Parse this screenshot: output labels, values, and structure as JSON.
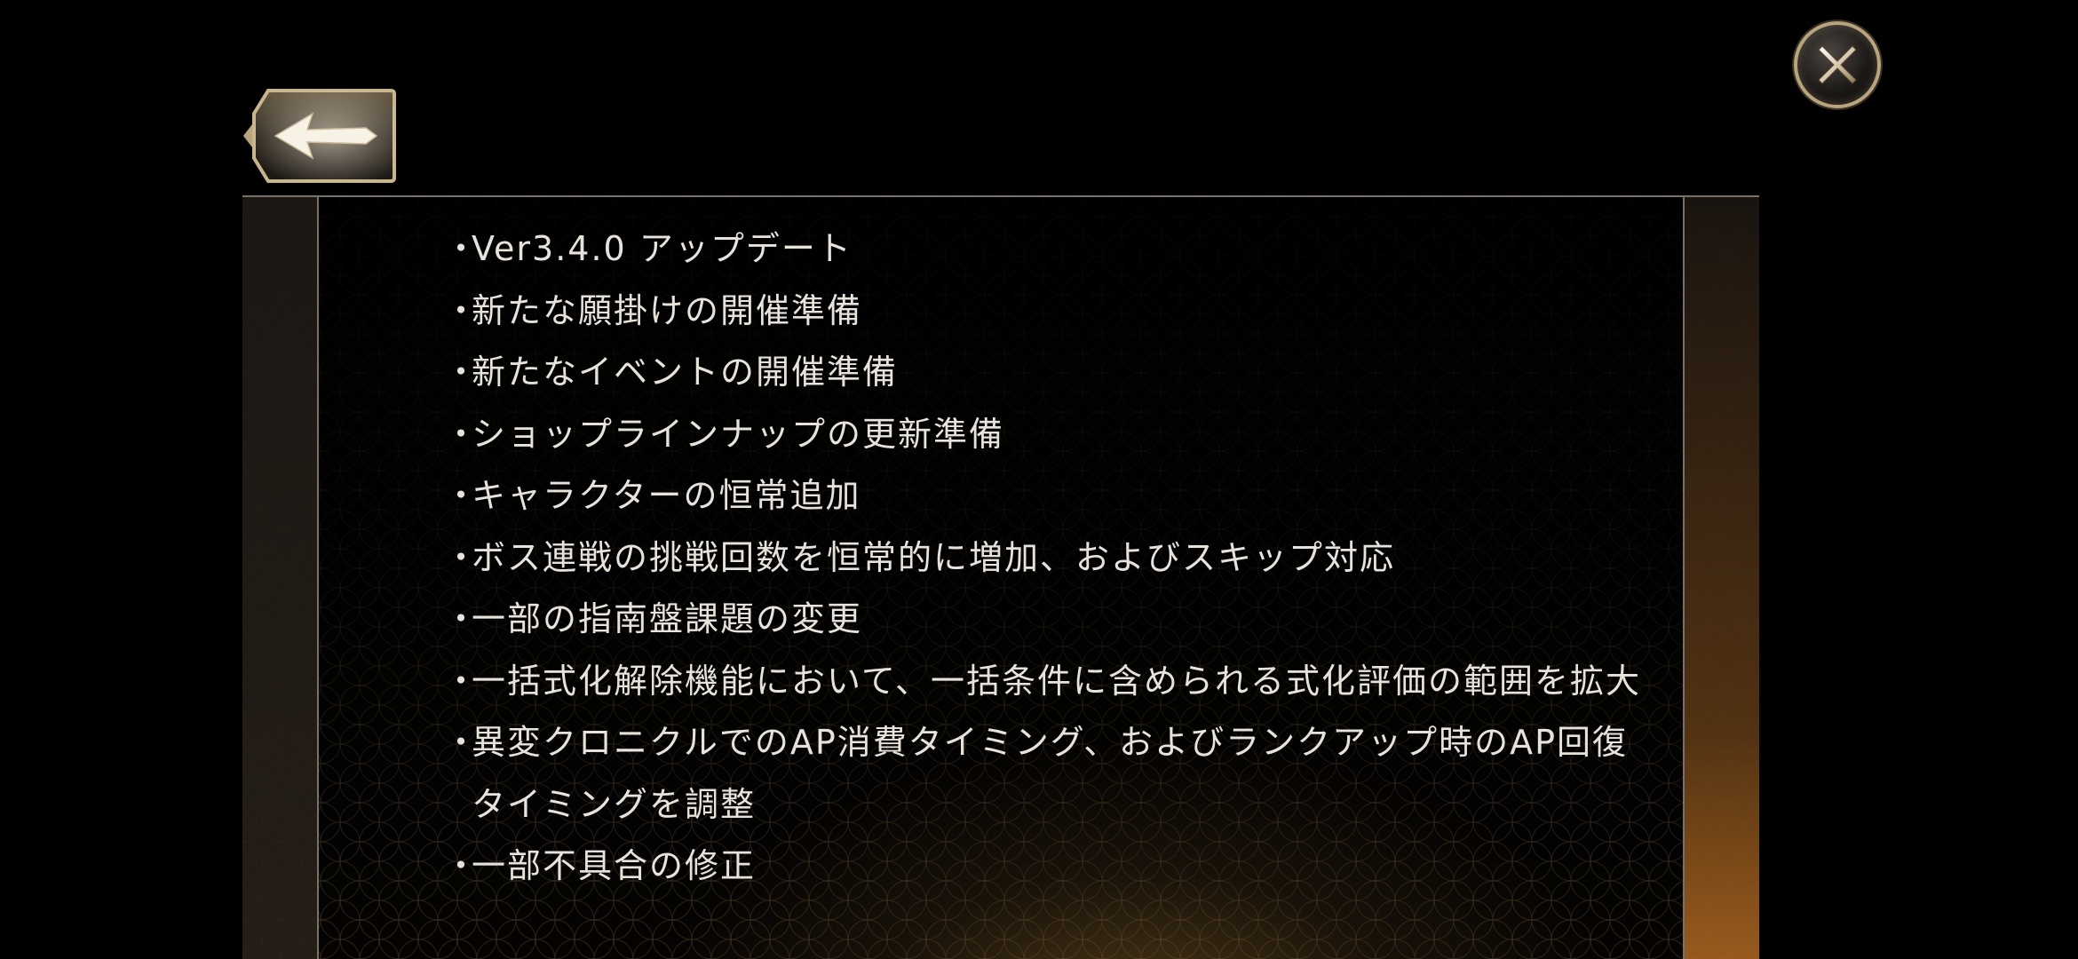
{
  "close": {
    "icon": "close-icon"
  },
  "back": {
    "icon": "back-arrow-icon"
  },
  "colors": {
    "background": "#000000",
    "frame_gold": "#b9a57c",
    "text": "#e8e3da",
    "divider": "#77716a"
  },
  "updates": {
    "bullet": "・",
    "items": [
      "Ver3.4.0 アップデート",
      "新たな願掛けの開催準備",
      "新たなイベントの開催準備",
      "ショップラインナップの更新準備",
      "キャラクターの恒常追加",
      "ボス連戦の挑戦回数を恒常的に増加、およびスキップ対応",
      "一部の指南盤課題の変更",
      "一括式化解除機能において、一括条件に含められる式化評価の範囲を拡大"
    ],
    "item_wrapped": {
      "line1": "異変クロニクルでのAP消費タイミング、およびランクアップ時のAP回復",
      "line2": "タイミングを調整"
    },
    "last_item": "一部不具合の修正"
  }
}
